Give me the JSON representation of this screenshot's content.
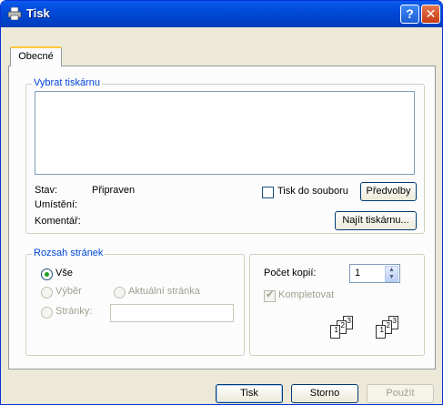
{
  "window": {
    "title": "Tisk"
  },
  "tabs": [
    {
      "label": "Obecné"
    }
  ],
  "printer_group": {
    "title": "Vybrat tiskárnu",
    "status_label": "Stav:",
    "status_value": "Připraven",
    "location_label": "Umístění:",
    "comment_label": "Komentář:",
    "print_to_file_label": "Tisk do souboru",
    "preferences_button": "Předvolby",
    "find_printer_button": "Najít tiskárnu..."
  },
  "range_group": {
    "title": "Rozsah stránek",
    "all_label": "Vše",
    "selection_label": "Výběr",
    "current_page_label": "Aktuální stránka",
    "pages_label": "Stránky:",
    "pages_value": ""
  },
  "copies": {
    "label": "Počet kopií:",
    "value": "1",
    "collate_label": "Kompletovat",
    "collate_checked": true,
    "page_numbers": [
      "1",
      "2",
      "3"
    ]
  },
  "buttons": {
    "print": "Tisk",
    "cancel": "Storno",
    "apply": "Použít"
  },
  "colors": {
    "title_bar": "#0a5bee",
    "group_title": "#0046d5",
    "window_bg": "#ece9d8"
  }
}
